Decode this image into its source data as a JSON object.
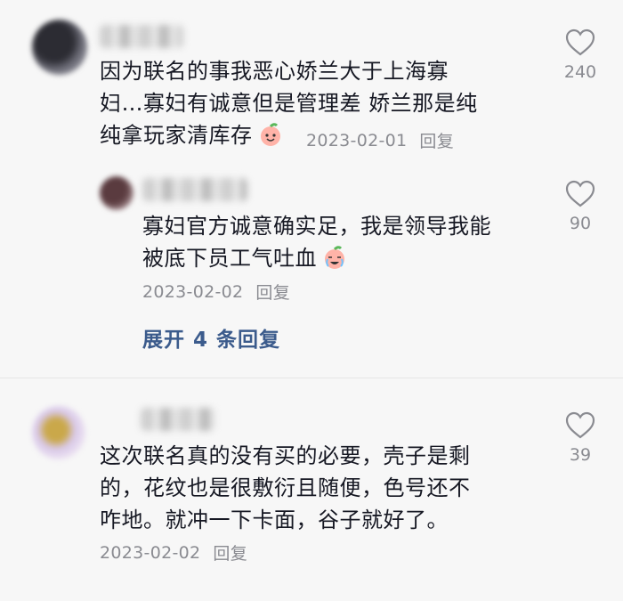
{
  "comments": [
    {
      "text_line1": "因为联名的事我恶心娇兰大于上海寡",
      "text_line2": "妇…寡妇有诚意但是管理差 娇兰那是纯",
      "text_line3": "纯拿玩家清库存",
      "emoji": "peach-smile-emoji",
      "date": "2023-02-01",
      "reply_label": "回复",
      "likes": "240",
      "replies": [
        {
          "text_line1": "寡妇官方诚意确实足，我是领导我能",
          "text_line2": "被底下员工气吐血",
          "emoji": "crying-laughing-emoji",
          "date": "2023-02-02",
          "reply_label": "回复",
          "likes": "90"
        }
      ],
      "expand_label": "展开 4 条回复"
    },
    {
      "text_line1": "这次联名真的没有买的必要，壳子是剩",
      "text_line2": "的，花纹也是很敷衍且随便，色号还不",
      "text_line3": "咋地。就冲一下卡面，谷子就好了。",
      "date": "2023-02-02",
      "reply_label": "回复",
      "likes": "39"
    }
  ],
  "icons": {
    "like": "heart-outline-icon"
  },
  "colors": {
    "link": "#3b5b8c",
    "meta": "#8a8b91",
    "text": "#161823"
  }
}
